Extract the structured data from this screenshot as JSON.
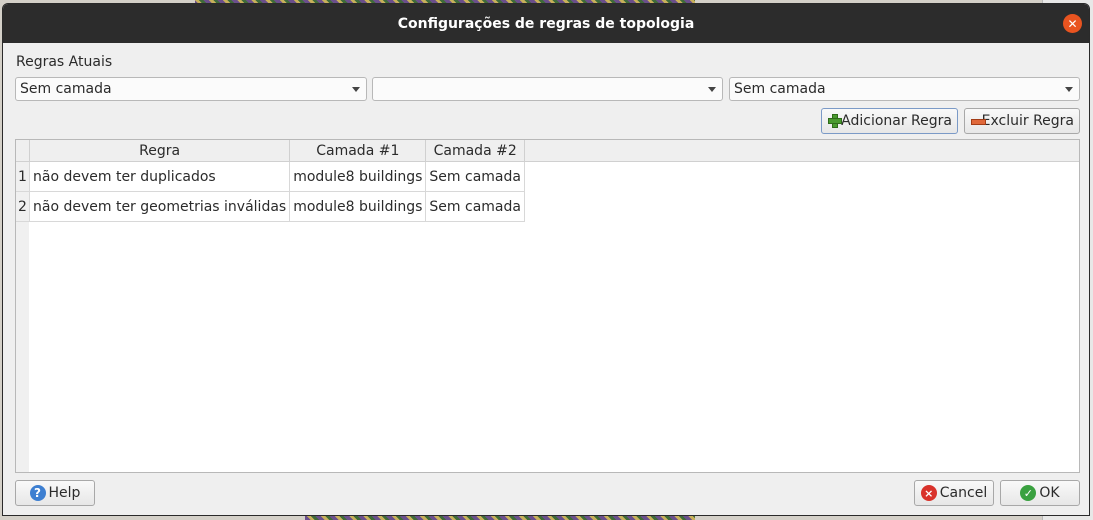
{
  "window": {
    "title": "Configurações de regras de topologia",
    "close_glyph": "✕"
  },
  "section": {
    "label": "Regras Atuais"
  },
  "selectors": {
    "rule": {
      "value": "Sem camada"
    },
    "layer1": {
      "value": ""
    },
    "layer2": {
      "value": "Sem camada"
    }
  },
  "actions": {
    "add_label": "Adicionar Regra",
    "remove_label": "Excluir Regra"
  },
  "table": {
    "headers": [
      "Regra",
      "Camada #1",
      "Camada #2"
    ],
    "rows": [
      {
        "num": "1",
        "rule": "não devem ter duplicados",
        "layer1": "module8 buildings",
        "layer2": "Sem camada"
      },
      {
        "num": "2",
        "rule": "não devem ter geometrias inválidas",
        "layer1": "module8 buildings",
        "layer2": "Sem camada"
      }
    ]
  },
  "footer": {
    "help_label": "Help",
    "cancel_label": "Cancel",
    "ok_label": "OK"
  },
  "icons": {
    "add": "plus-icon",
    "remove": "minus-icon",
    "help": "help-icon",
    "cancel": "cancel-icon",
    "ok": "check-icon",
    "close": "close-icon"
  },
  "colors": {
    "titlebar": "#2c2c2c",
    "close_button": "#e95420",
    "dialog_bg": "#efefef"
  }
}
